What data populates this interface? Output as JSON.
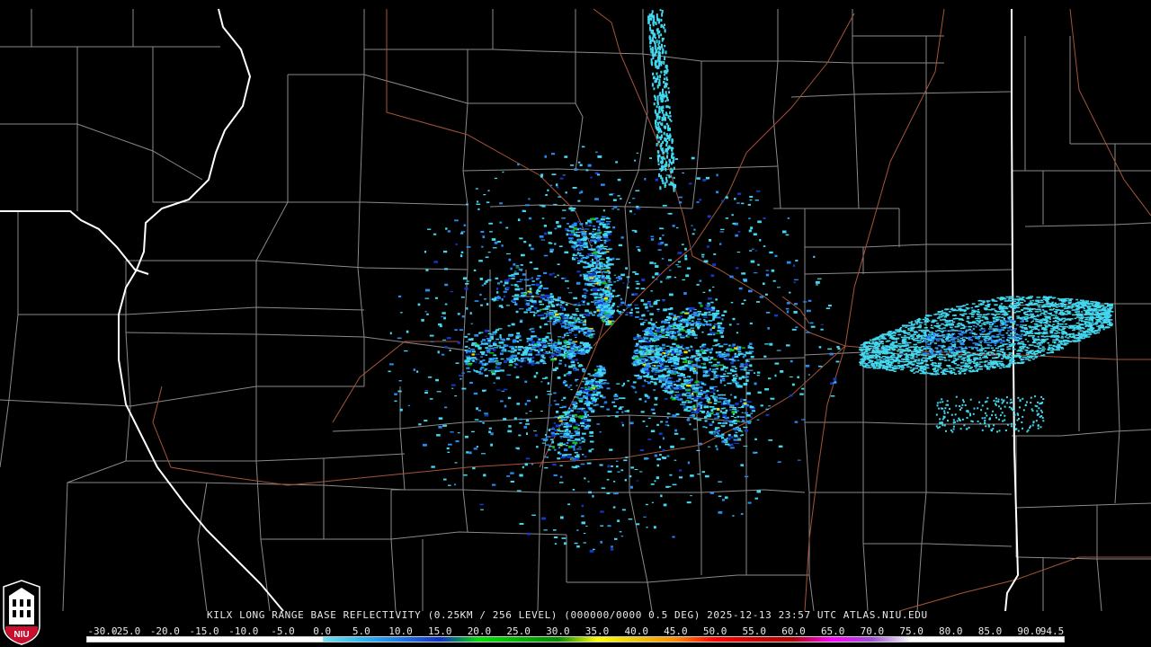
{
  "product_title": "KILX LONG RANGE BASE REFLECTIVITY (0.25KM / 256 LEVEL) (000000/0000 0.5 DEG) 2025-12-13 23:57 UTC  ATLAS.NIU.EDU",
  "logo_text": "NIU",
  "legend": {
    "ticks": [
      "-30.0",
      "-25.0",
      "-20.0",
      "-15.0",
      "-10.0",
      "-5.0",
      "0.0",
      "5.0",
      "10.0",
      "15.0",
      "20.0",
      "25.0",
      "30.0",
      "35.0",
      "40.0",
      "45.0",
      "50.0",
      "55.0",
      "60.0",
      "65.0",
      "70.0",
      "75.0",
      "80.0",
      "85.0",
      "90.0",
      "94.5"
    ],
    "min": -30.0,
    "max": 94.5,
    "color_stops": [
      {
        "value": -30,
        "color": "#ffffff"
      },
      {
        "value": 0,
        "color": "#ffffff"
      },
      {
        "value": 0.1,
        "color": "#6fe0f0"
      },
      {
        "value": 5,
        "color": "#2bb8f0"
      },
      {
        "value": 10,
        "color": "#1e78e6"
      },
      {
        "value": 15,
        "color": "#1030c8"
      },
      {
        "value": 20,
        "color": "#00e000"
      },
      {
        "value": 25,
        "color": "#00b400"
      },
      {
        "value": 30,
        "color": "#008a00"
      },
      {
        "value": 35,
        "color": "#ffff00"
      },
      {
        "value": 40,
        "color": "#f0c800"
      },
      {
        "value": 45,
        "color": "#ff8c00"
      },
      {
        "value": 50,
        "color": "#ff0000"
      },
      {
        "value": 55,
        "color": "#d00000"
      },
      {
        "value": 60,
        "color": "#b00000"
      },
      {
        "value": 65,
        "color": "#ff00ff"
      },
      {
        "value": 70,
        "color": "#9a50d0"
      },
      {
        "value": 75,
        "color": "#ffffff"
      },
      {
        "value": 94.5,
        "color": "#ffffff"
      }
    ]
  },
  "colors": {
    "background": "#000000",
    "county_lines": "#8a8a8a",
    "state_lines": "#ffffff",
    "highways": "#a5553a",
    "echo_light": "#43d8f0",
    "echo_medium": "#2a8cf0",
    "echo_heavy": "#1438c8",
    "echo_green": "#10c010",
    "echo_yellow": "#f0e000"
  }
}
